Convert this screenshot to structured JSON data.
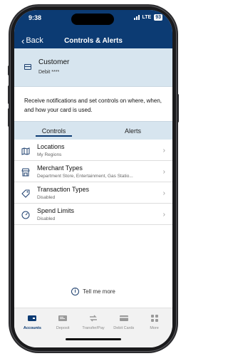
{
  "status": {
    "time": "9:38",
    "network": "LTE",
    "battery": "93"
  },
  "nav": {
    "back_label": "Back",
    "title": "Controls & Alerts"
  },
  "customer": {
    "name": "Customer",
    "card": "Debit ****",
    "icon": "card-icon"
  },
  "description": "Receive notifications and set controls on where, when, and how your card is used.",
  "tabs": [
    {
      "label": "Controls",
      "active": true
    },
    {
      "label": "Alerts",
      "active": false
    }
  ],
  "controls": [
    {
      "title": "Locations",
      "subtitle": "My Regions",
      "icon": "map-icon"
    },
    {
      "title": "Merchant Types",
      "subtitle": "Department Store, Entertainment, Gas Statio...",
      "icon": "storefront-icon"
    },
    {
      "title": "Transaction Types",
      "subtitle": "Disabled",
      "icon": "tag-icon"
    },
    {
      "title": "Spend Limits",
      "subtitle": "Disabled",
      "icon": "gauge-icon"
    }
  ],
  "tell_me_more": "Tell me more",
  "tabbar": [
    {
      "label": "Accounts",
      "active": true,
      "icon": "accounts-icon"
    },
    {
      "label": "Deposit",
      "active": false,
      "icon": "deposit-icon"
    },
    {
      "label": "Transfer/Pay",
      "active": false,
      "icon": "transfer-icon"
    },
    {
      "label": "Debit Cards",
      "active": false,
      "icon": "debit-card-icon"
    },
    {
      "label": "More",
      "active": false,
      "icon": "more-icon"
    }
  ],
  "colors": {
    "brand": "#0c3b73",
    "accent_light": "#d7e5ef"
  }
}
